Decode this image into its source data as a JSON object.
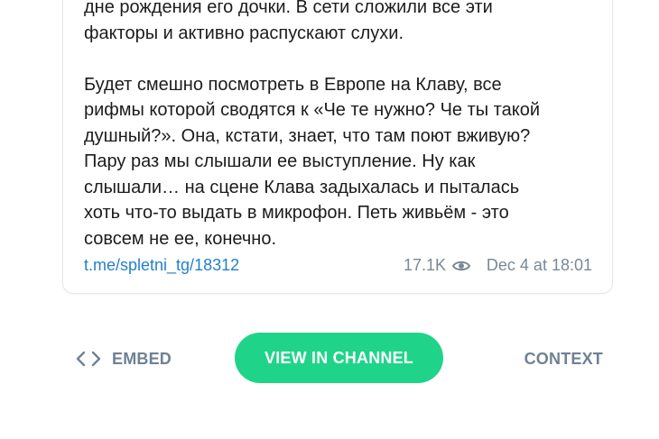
{
  "post": {
    "text": "дне рождения его дочки. В сети сложили все эти\nфакторы и активно распускают слухи.\n\nБудет смешно посмотреть в Европе на Клаву, все\nрифмы которой сводятся к «Че те нужно? Че ты такой\nдушный?». Она, кстати, знает, что там поют вживую?\nПару раз мы слышали ее выступление. Ну как\nслышали… на сцене Клава задыхалась и пыталась\nхоть что-то выдать в микрофон. Петь живьём - это\nсовсем не ее, конечно.",
    "link": "t.me/spletni_tg/18312",
    "views": "17.1K",
    "date": "Dec 4 at 18:01"
  },
  "actions": {
    "embed_label": "EMBED",
    "view_channel_label": "VIEW IN CHANNEL",
    "context_label": "CONTEXT"
  },
  "icons": {
    "views": "eye-icon",
    "embed": "code-icon"
  },
  "colors": {
    "accent_green": "#1fd489",
    "link_blue": "#2481cc",
    "muted_gray": "#7a8896",
    "action_gray": "#6f8194"
  }
}
